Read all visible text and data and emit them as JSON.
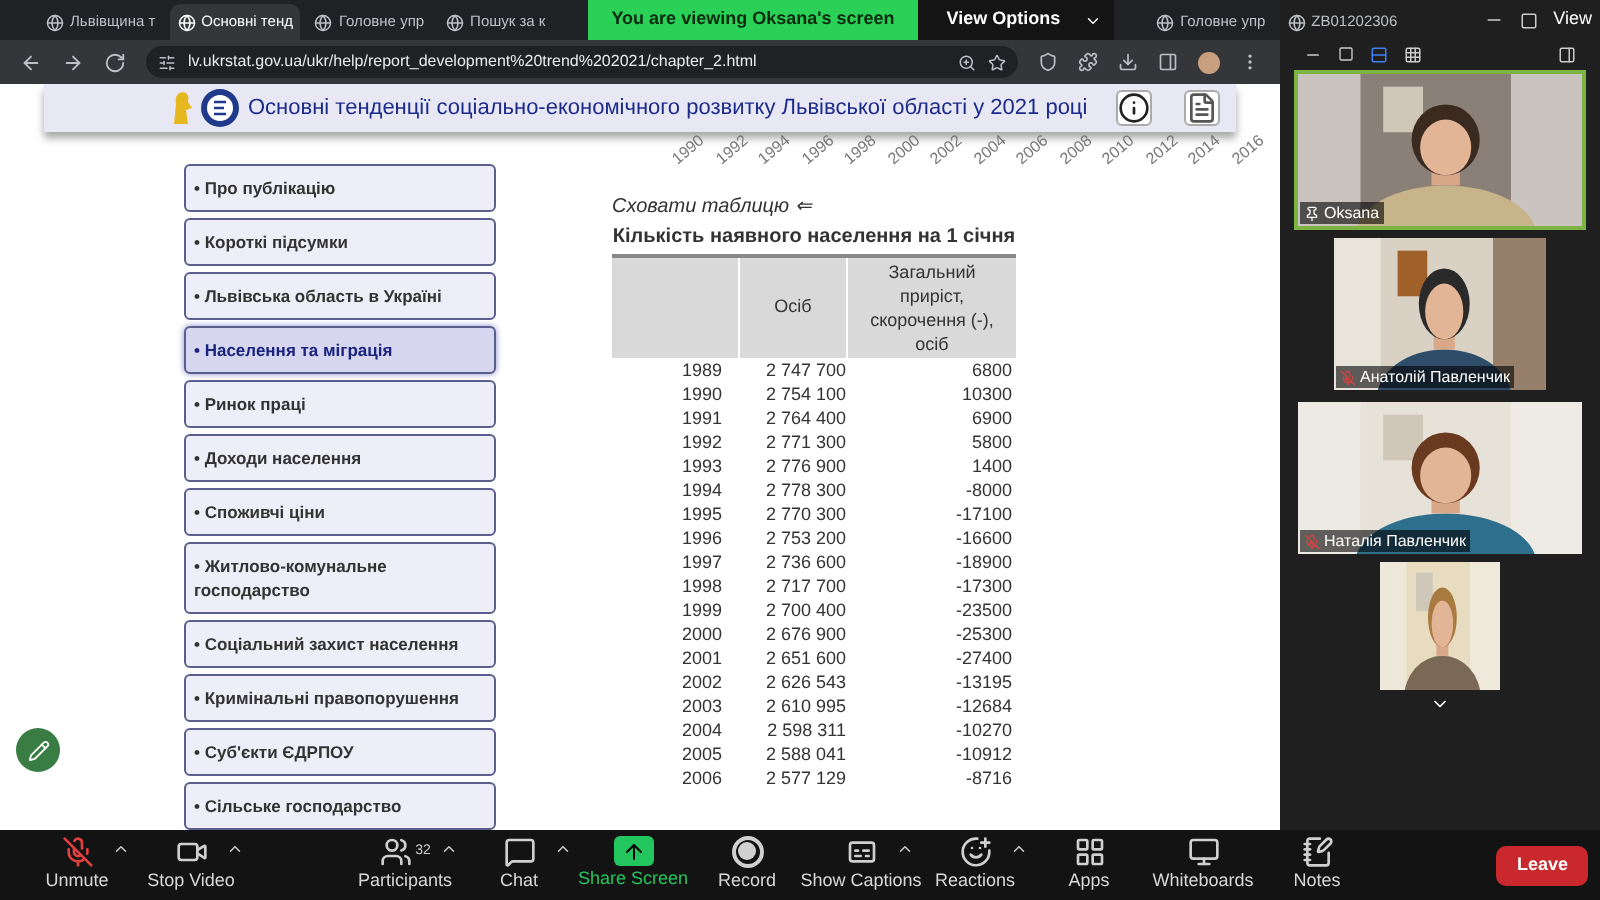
{
  "banner": {
    "text": "You are viewing Oksana's screen",
    "options": "View Options"
  },
  "window": {
    "view": "View"
  },
  "browser": {
    "tabs": [
      {
        "label": "Львівщина т",
        "selected": false
      },
      {
        "label": "Основні тенд",
        "selected": true
      },
      {
        "label": "Головне упр",
        "selected": false
      },
      {
        "label": "Пошук за к",
        "selected": false
      },
      {
        "label": "Головне упр",
        "selected": false
      },
      {
        "label": "ZB01202306",
        "selected": false
      }
    ],
    "url": "lv.ukrstat.gov.ua/ukr/help/report_development%20trend%202021/chapter_2.html"
  },
  "page": {
    "title": "Основні тенденції соціально-економічного розвитку Львівської області у 2021 році",
    "axis_years": [
      "1990",
      "1992",
      "1994",
      "1996",
      "1998",
      "2000",
      "2002",
      "2004",
      "2006",
      "2008",
      "2010",
      "2012",
      "2014",
      "2016"
    ],
    "nav": [
      {
        "label": "• Про публікацію",
        "selected": false
      },
      {
        "label": "• Короткі підсумки",
        "selected": false
      },
      {
        "label": "• Львівська область в Україні",
        "selected": false
      },
      {
        "label": "• Населення та міграція",
        "selected": true
      },
      {
        "label": "• Ринок праці",
        "selected": false
      },
      {
        "label": "• Доходи населення",
        "selected": false
      },
      {
        "label": "• Споживчі ціни",
        "selected": false
      },
      {
        "label": "• Житлово-комунальне господарство",
        "selected": false
      },
      {
        "label": "• Соціальний захист населення",
        "selected": false
      },
      {
        "label": "• Кримінальні правопорушення",
        "selected": false
      },
      {
        "label": "• Суб'єкти ЄДРПОУ",
        "selected": false
      },
      {
        "label": "• Сільське господарство",
        "selected": false
      }
    ],
    "table": {
      "toggle": "Сховати таблицю ⇐",
      "caption": "Кількість наявного населення на 1 січня",
      "columns": [
        "",
        "Осіб",
        "Загальний приріст, скорочення (-), осіб"
      ],
      "rows": [
        [
          "1989",
          "2 747 700",
          "6800"
        ],
        [
          "1990",
          "2 754 100",
          "10300"
        ],
        [
          "1991",
          "2 764 400",
          "6900"
        ],
        [
          "1992",
          "2 771 300",
          "5800"
        ],
        [
          "1993",
          "2 776 900",
          "1400"
        ],
        [
          "1994",
          "2 778 300",
          "-8000"
        ],
        [
          "1995",
          "2 770 300",
          "-17100"
        ],
        [
          "1996",
          "2 753 200",
          "-16600"
        ],
        [
          "1997",
          "2 736 600",
          "-18900"
        ],
        [
          "1998",
          "2 717 700",
          "-17300"
        ],
        [
          "1999",
          "2 700 400",
          "-23500"
        ],
        [
          "2000",
          "2 676 900",
          "-25300"
        ],
        [
          "2001",
          "2 651 600",
          "-27400"
        ],
        [
          "2002",
          "2 626 543",
          "-13195"
        ],
        [
          "2003",
          "2 610 995",
          "-12684"
        ],
        [
          "2004",
          "2 598 311",
          "-10270"
        ],
        [
          "2005",
          "2 588 041",
          "-10912"
        ],
        [
          "2006",
          "2 577 129",
          "-8716"
        ]
      ]
    }
  },
  "participants": [
    {
      "name": "Oksana",
      "pinned": true,
      "muted": false,
      "highlighted": true
    },
    {
      "name": "Анатолій Павленчик",
      "pinned": false,
      "muted": true,
      "highlighted": false
    },
    {
      "name": "Наталія Павленчик",
      "pinned": false,
      "muted": true,
      "highlighted": false
    }
  ],
  "toolbar": [
    {
      "kind": "mic-off",
      "label": "Unmute",
      "menu": true
    },
    {
      "kind": "video",
      "label": "Stop Video",
      "menu": true
    },
    {
      "kind": "participants",
      "label": "Participants",
      "count": "32",
      "menu": true
    },
    {
      "kind": "chat",
      "label": "Chat",
      "menu": true
    },
    {
      "kind": "share",
      "label": "Share Screen",
      "menu": false
    },
    {
      "kind": "record",
      "label": "Record",
      "menu": false
    },
    {
      "kind": "captions",
      "label": "Show Captions",
      "menu": true
    },
    {
      "kind": "reactions",
      "label": "Reactions",
      "menu": true
    },
    {
      "kind": "apps",
      "label": "Apps",
      "menu": false
    },
    {
      "kind": "whiteboards",
      "label": "Whiteboards",
      "menu": false
    },
    {
      "kind": "notes",
      "label": "Notes",
      "menu": false
    }
  ],
  "leave": "Leave"
}
